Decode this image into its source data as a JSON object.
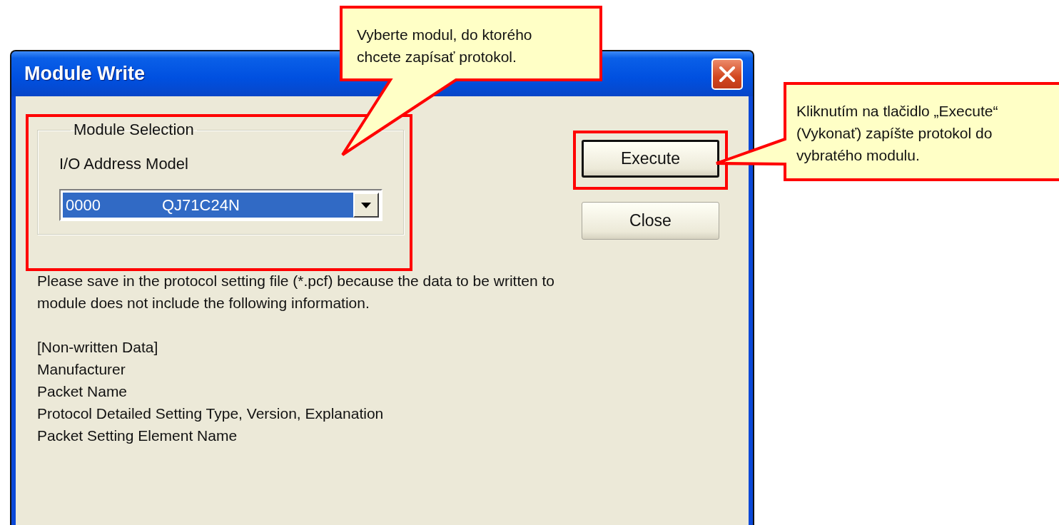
{
  "window": {
    "title": "Module Write"
  },
  "module_selection": {
    "legend": "Module Selection",
    "label": "I/O Address Model",
    "combo": {
      "address": "0000",
      "model": "QJ71C24N",
      "selected": true
    }
  },
  "buttons": [
    {
      "label": "Execute",
      "focused": true
    },
    {
      "label": "Close",
      "focused": false
    }
  ],
  "message": [
    "Please save in the protocol setting file (*.pcf) because the data to be written to",
    "module does not include the following information."
  ],
  "info_lines": [
    "[Non-written Data]",
    "Manufacturer",
    "Packet Name",
    "Protocol Detailed Setting Type, Version, Explanation",
    "Packet Setting Element Name"
  ],
  "callouts": [
    {
      "lines": [
        "Vyberte modul, do ktorého",
        "chcete zapísať protokol."
      ]
    },
    {
      "lines": [
        "Kliknutím na tlačidlo „Execute“",
        "(Vykonať) zapíšte protokol do",
        "vybratého modulu."
      ]
    }
  ]
}
